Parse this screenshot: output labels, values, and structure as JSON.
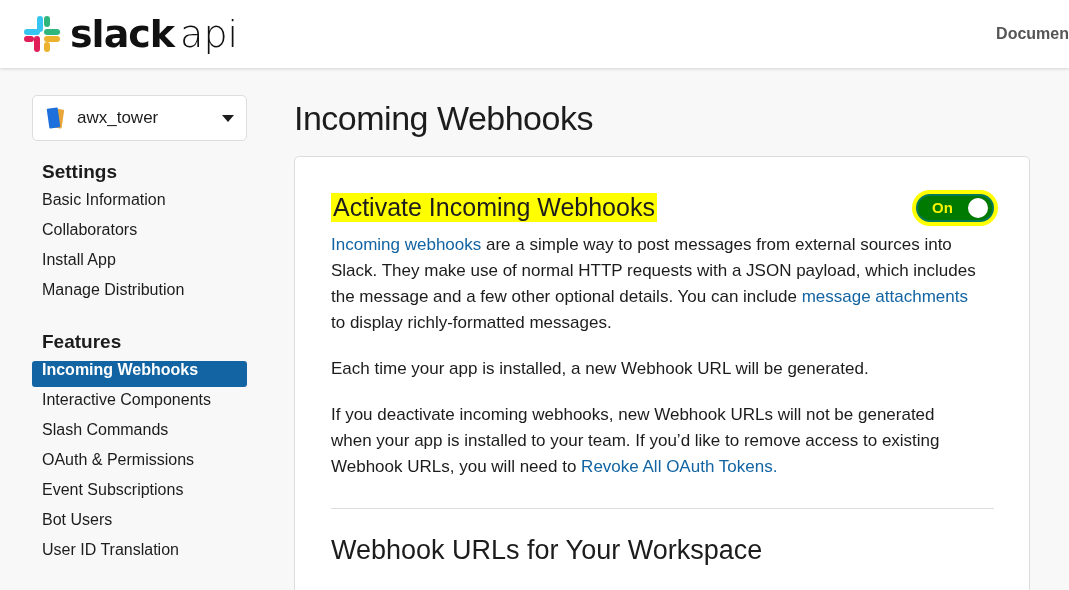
{
  "header": {
    "logo_word": "slack",
    "logo_suffix": "api",
    "nav_items": [
      "Documen"
    ]
  },
  "app_selector": {
    "value": "awx_tower"
  },
  "sidebar": {
    "sections": [
      {
        "title": "Settings",
        "items": [
          {
            "label": "Basic Information",
            "selected": false
          },
          {
            "label": "Collaborators",
            "selected": false
          },
          {
            "label": "Install App",
            "selected": false
          },
          {
            "label": "Manage Distribution",
            "selected": false
          }
        ]
      },
      {
        "title": "Features",
        "items": [
          {
            "label": "Incoming Webhooks",
            "selected": true
          },
          {
            "label": "Interactive Components",
            "selected": false
          },
          {
            "label": "Slash Commands",
            "selected": false
          },
          {
            "label": "OAuth & Permissions",
            "selected": false
          },
          {
            "label": "Event Subscriptions",
            "selected": false
          },
          {
            "label": "Bot Users",
            "selected": false
          },
          {
            "label": "User ID Translation",
            "selected": false
          }
        ]
      }
    ]
  },
  "page_title": "Incoming Webhooks",
  "card": {
    "heading": "Activate Incoming Webhooks",
    "toggle": {
      "label": "On",
      "on": true
    },
    "paragraphs": [
      [
        {
          "text": "Incoming webhooks",
          "kind": "link"
        },
        {
          "text": " are a simple way to post messages from external sources into Slack. They make use of normal HTTP requests with a JSON payload, which includes the message and a few other optional details. You can include ",
          "kind": "text"
        },
        {
          "text": "message attachments",
          "kind": "link"
        },
        {
          "text": " to display richly-formatted messages.",
          "kind": "text"
        }
      ],
      [
        {
          "text": "Each time your app is installed, a new Webhook URL will be generated.",
          "kind": "text"
        }
      ],
      [
        {
          "text": "If you deactivate incoming webhooks, new Webhook URLs will not be generated when your app is installed to your team. If you’d like to remove access to existing Webhook URLs, you will need to ",
          "kind": "text"
        },
        {
          "text": "Revoke All OAuth Tokens.",
          "kind": "link"
        }
      ]
    ],
    "subheading": "Webhook URLs for Your Workspace"
  }
}
